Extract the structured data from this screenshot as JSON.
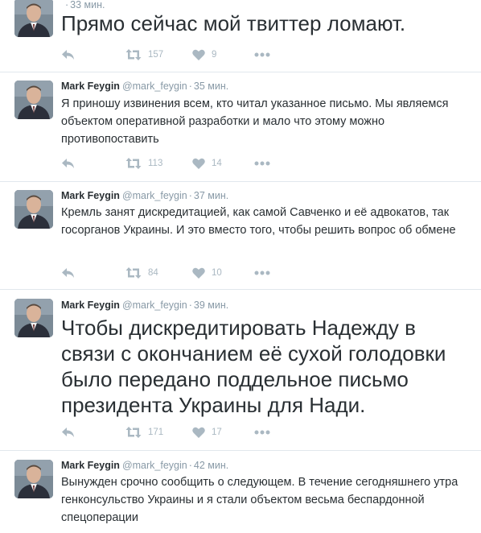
{
  "tweets": [
    {
      "name": "",
      "handle": "",
      "separator": "·",
      "time": "33 мин.",
      "text": "Прямо сейчас мой твиттер ломают.",
      "retweets": "157",
      "likes": "9"
    },
    {
      "name": "Mark Feygin",
      "handle": "@mark_feygin",
      "separator": "·",
      "time": "35 мин.",
      "text": "Я приношу извинения всем, кто читал указанное письмо. Мы являемся объектом оперативной разработки и мало что этому можно противопоставить",
      "retweets": "113",
      "likes": "14"
    },
    {
      "name": "Mark Feygin",
      "handle": "@mark_feygin",
      "separator": "·",
      "time": "37 мин.",
      "text": "Кремль занят дискредитацией, как самой Савченко и её адвокатов, так госорганов Украины. И это вместо того, чтобы решить вопрос об обмене",
      "retweets": "84",
      "likes": "10"
    },
    {
      "name": "Mark Feygin",
      "handle": "@mark_feygin",
      "separator": "·",
      "time": "39 мин.",
      "text": "Чтобы дискредитировать Надежду в связи с окончанием её сухой голодовки было передано поддельное письмо президента Украины для Нади.",
      "retweets": "171",
      "likes": "17"
    },
    {
      "name": "Mark Feygin",
      "handle": "@mark_feygin",
      "separator": "·",
      "time": "42 мин.",
      "text": "Вынужден срочно сообщить о следующем. В течение сегодняшнего утра генконсульство Украины и я стали объектом весьма беспардонной спецоперации",
      "retweets": "",
      "likes": ""
    }
  ],
  "icons": {
    "reply": "reply-icon",
    "retweet": "retweet-icon",
    "like": "heart-icon",
    "more": "more-icon"
  },
  "colors": {
    "action_gray": "#aab8c2",
    "meta_gray": "#8899a6",
    "text": "#292f33",
    "divider": "#e1e8ed"
  }
}
